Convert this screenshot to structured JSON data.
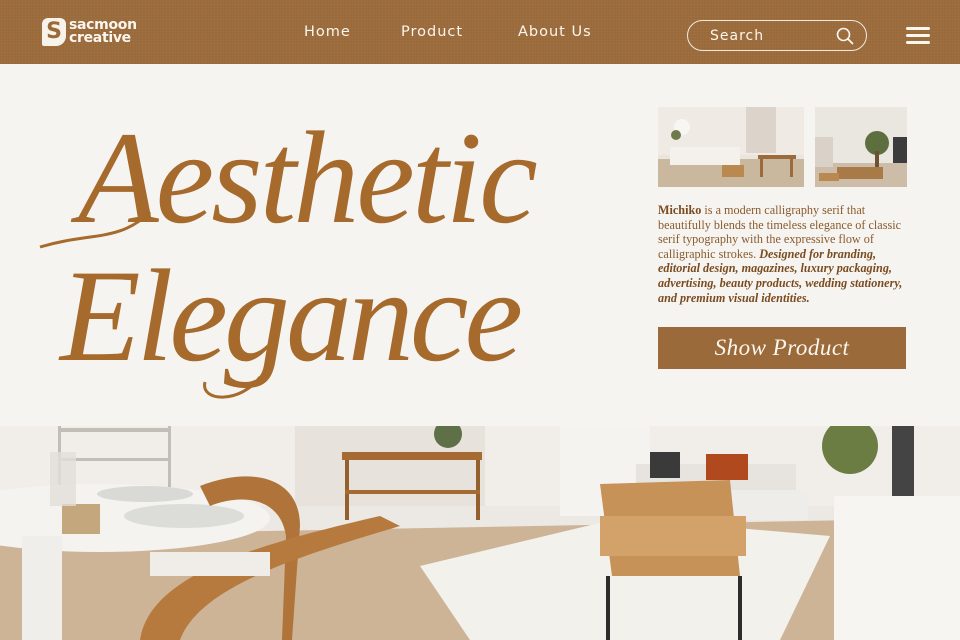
{
  "brand": {
    "mark": "S",
    "line1": "sacmoon",
    "line2": "creative"
  },
  "nav": {
    "items": [
      "Home",
      "Product",
      "About Us"
    ]
  },
  "search": {
    "placeholder": "Search",
    "icon": "search-icon"
  },
  "menu": {
    "icon": "hamburger-menu-icon"
  },
  "hero": {
    "title_line1": "Aesthetic",
    "title_line2": "Elegance"
  },
  "description": {
    "font_name": "Michiko",
    "text": " is a modern calligraphy serif that beautifully blends the timeless elegance of classic serif typography with the expressive flow of calligraphic strokes. ",
    "emphasis": "Designed for branding, editorial design, magazines, luxury packaging, advertising, beauty products, wedding stationery, and premium visual identities."
  },
  "cta": {
    "label": "Show Product"
  },
  "colors": {
    "accent": "#9a6a3a",
    "text_brown": "#8a5a2c",
    "background": "#f6f4f1",
    "light": "#fbf6ee"
  }
}
